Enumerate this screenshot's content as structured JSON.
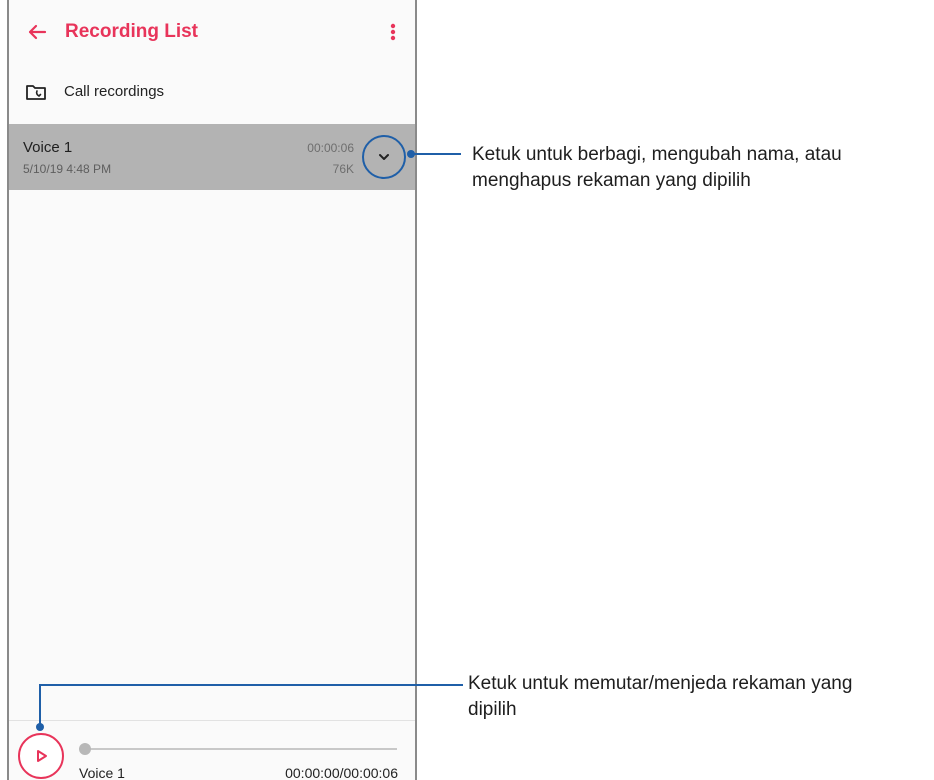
{
  "app": {
    "title": "Recording List"
  },
  "folder": {
    "label": "Call recordings"
  },
  "recordings": [
    {
      "name": "Voice 1",
      "date": "5/10/19 4:48 PM",
      "duration": "00:00:06",
      "size": "76K"
    }
  ],
  "player": {
    "name": "Voice 1",
    "time": "00:00:00/00:00:06",
    "progress": 0
  },
  "callouts": {
    "expand": {
      "line1": "Ketuk untuk berbagi, mengubah nama, atau",
      "line2": "menghapus rekaman yang dipilih"
    },
    "play": {
      "line1": "Ketuk untuk memutar/menjeda rekaman yang",
      "line2": "dipilih"
    }
  },
  "colors": {
    "accent": "#e8345a",
    "callout": "#1f5fa8",
    "selected_row": "#b3b3b3"
  },
  "icons": {
    "back": "arrow-left-icon",
    "more": "more-vertical-icon",
    "folder": "folder-call-icon",
    "expand": "chevron-down-icon",
    "play": "play-icon"
  }
}
